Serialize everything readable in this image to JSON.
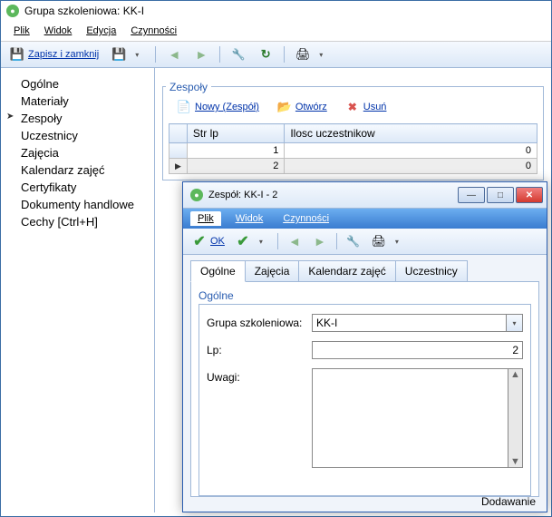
{
  "window": {
    "title": "Grupa szkoleniowa: KK-I"
  },
  "menu": {
    "plik": "Plik",
    "widok": "Widok",
    "edycja": "Edycja",
    "czynnosci": "Czynności"
  },
  "toolbar": {
    "save_close": "Zapisz i zamknij"
  },
  "sidebar": {
    "items": [
      {
        "label": "Ogólne"
      },
      {
        "label": "Materiały"
      },
      {
        "label": "Zespoły"
      },
      {
        "label": "Uczestnicy"
      },
      {
        "label": "Zajęcia"
      },
      {
        "label": "Kalendarz zajęć"
      },
      {
        "label": "Certyfikaty"
      },
      {
        "label": "Dokumenty handlowe"
      },
      {
        "label": "Cechy [Ctrl+H]"
      }
    ]
  },
  "content": {
    "group_label": "Zespoły",
    "btn_new": "Nowy (Zespół)",
    "btn_open": "Otwórz",
    "btn_delete": "Usuń",
    "table": {
      "col1": "Str lp",
      "col2": "Ilosc uczestnikow",
      "rows": [
        {
          "lp": "1",
          "count": "0"
        },
        {
          "lp": "2",
          "count": "0"
        }
      ]
    }
  },
  "dialog": {
    "title": "Zespół: KK-I - 2",
    "menu": {
      "plik": "Plik",
      "widok": "Widok",
      "czynnosci": "Czynności"
    },
    "toolbar": {
      "ok": "OK"
    },
    "tabs": {
      "ogolne": "Ogólne",
      "zajecia": "Zajęcia",
      "kalendarz": "Kalendarz zajęć",
      "uczestnicy": "Uczestnicy"
    },
    "fieldset": "Ogólne",
    "form": {
      "grupa_label": "Grupa szkoleniowa:",
      "grupa_value": "KK-I",
      "lp_label": "Lp:",
      "lp_value": "2",
      "uwagi_label": "Uwagi:",
      "uwagi_value": ""
    },
    "status": "Dodawanie"
  }
}
